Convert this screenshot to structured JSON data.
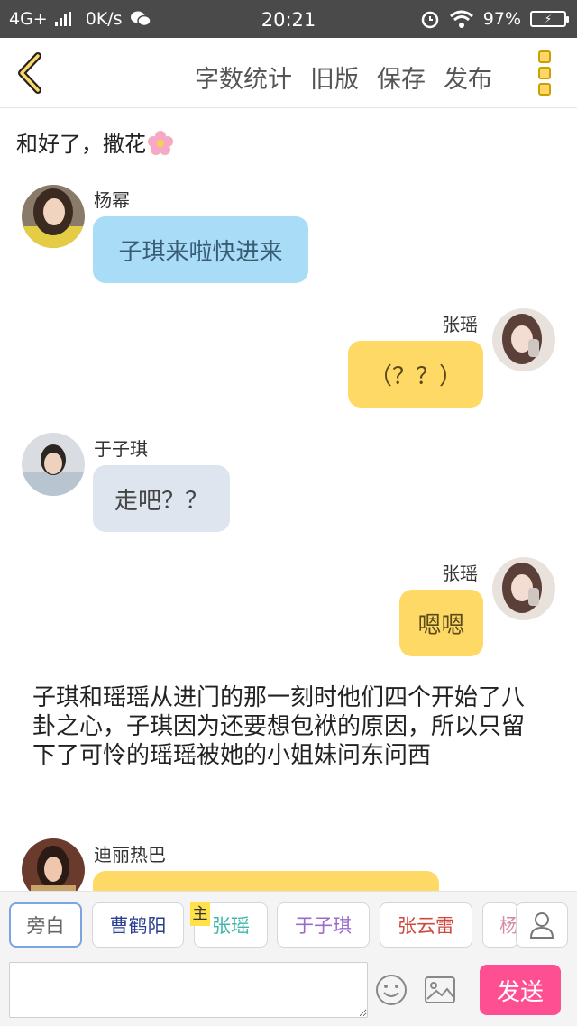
{
  "status_bar": {
    "network": "4G+",
    "speed": "0K/s",
    "time": "20:21",
    "battery": "97%"
  },
  "toolbar": {
    "word_count": "字数统计",
    "old_version": "旧版",
    "save": "保存",
    "publish": "发布"
  },
  "chapter": {
    "title": "和好了，撒花"
  },
  "messages": [
    {
      "speaker": "杨幂",
      "text": "子琪来啦快进来",
      "side": "left",
      "bubble_color": "#a8dcf7",
      "text_color": "#3a5b74"
    },
    {
      "speaker": "张瑶",
      "text": "（？？）",
      "side": "right",
      "bubble_color": "#ffd966",
      "text_color": "#5a4a1a"
    },
    {
      "speaker": "于子琪",
      "text": "走吧？？",
      "side": "left",
      "bubble_color": "#dfe5ee",
      "text_color": "#444444"
    },
    {
      "speaker": "张瑶",
      "text": "嗯嗯",
      "side": "right",
      "bubble_color": "#ffd966",
      "text_color": "#5a4a1a"
    }
  ],
  "narration": "子琪和瑶瑶从进门的那一刻时他们四个开始了八卦之心，子琪因为还要想包袱的原因，所以只留下了可怜的瑶瑶被她的小姐妹问东问西",
  "last_message": {
    "speaker": "迪丽热巴",
    "bubble_color": "#ffd966"
  },
  "roles": [
    {
      "label": "旁白",
      "color": "#666666"
    },
    {
      "label": "曹鹤阳",
      "color": "#2a3f8f"
    },
    {
      "label": "张瑶",
      "color": "#3fb8a8"
    },
    {
      "label": "于子琪",
      "color": "#9b6bc9"
    },
    {
      "label": "张云雷",
      "color": "#d0473c"
    },
    {
      "label": "杨",
      "color": "#d98aa6"
    }
  ],
  "main_tag": "主",
  "input": {
    "placeholder": "",
    "send_label": "发送"
  },
  "colors": {
    "accent": "#ffd766",
    "send": "#ff4f93",
    "statusbar": "#4a4a4a"
  },
  "icons": [
    "back-icon",
    "more-icon",
    "flower-icon",
    "emoji-icon",
    "image-icon",
    "user-icon",
    "wifi-icon",
    "alarm-icon",
    "wechat-icon"
  ]
}
